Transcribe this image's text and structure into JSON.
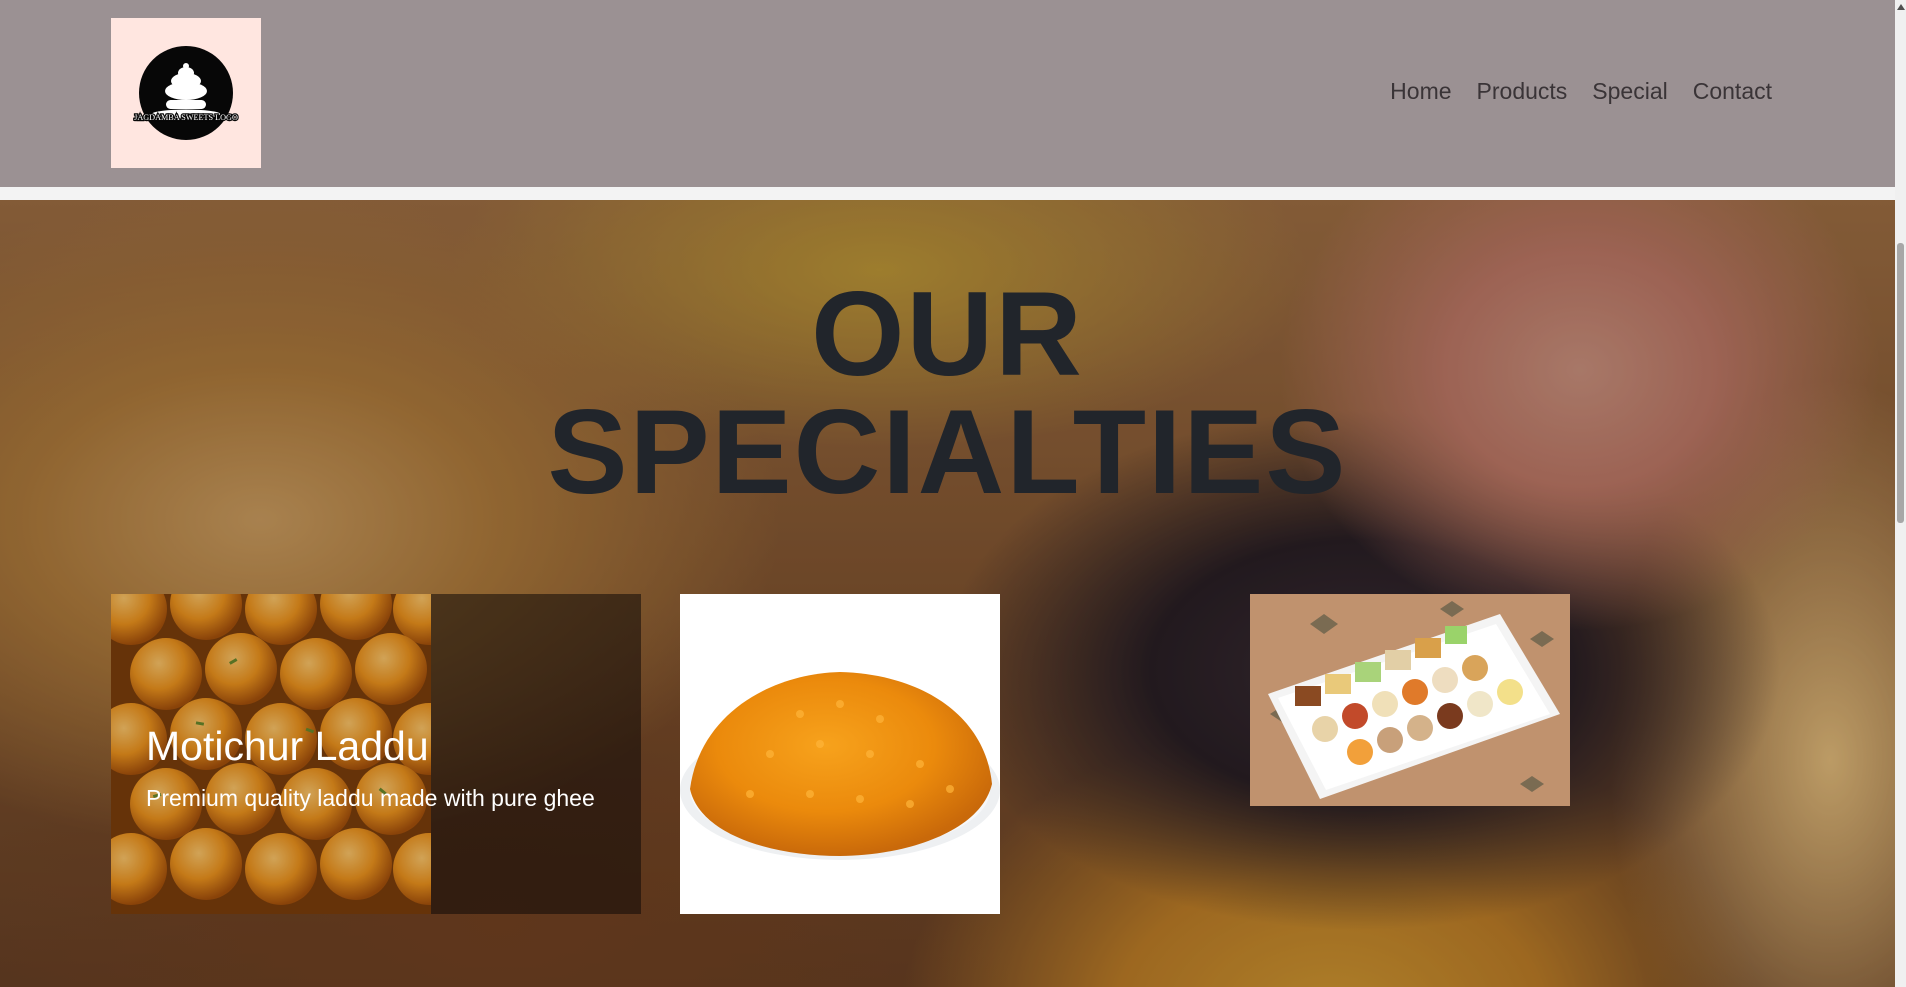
{
  "header": {
    "logo_text": "JAGDAMBA SWEETS LOGO",
    "nav": [
      {
        "label": "Home"
      },
      {
        "label": "Products"
      },
      {
        "label": "Special"
      },
      {
        "label": "Contact"
      }
    ]
  },
  "hero": {
    "title_line1": "OUR",
    "title_line2": "SPECIALTIES"
  },
  "cards": [
    {
      "name": "Motichur Laddu",
      "description": "Premium quality laddu made with pure ghee"
    }
  ],
  "colors": {
    "navbar": "#9b9193",
    "logo_bg": "#ffe6e0",
    "title_text": "#21252b",
    "nav_text": "#3a3437"
  }
}
